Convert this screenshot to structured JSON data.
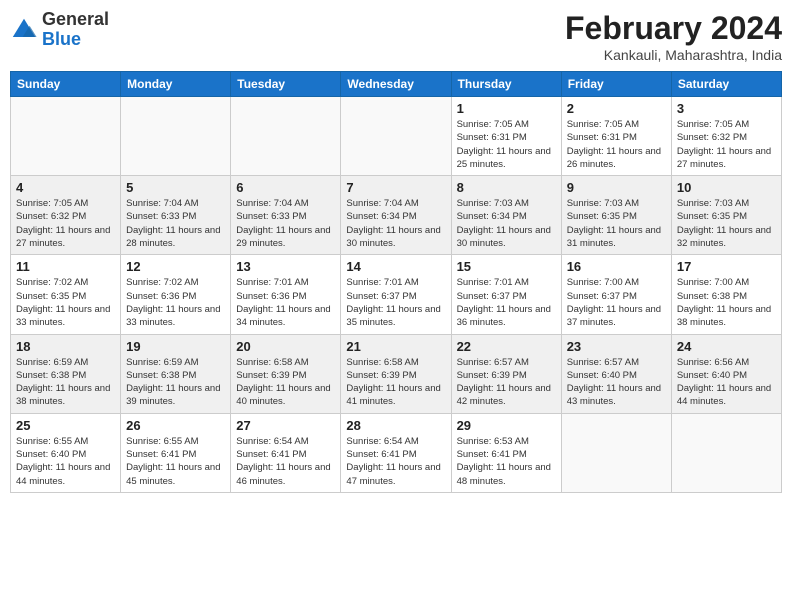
{
  "logo": {
    "general": "General",
    "blue": "Blue"
  },
  "header": {
    "month_year": "February 2024",
    "location": "Kankauli, Maharashtra, India"
  },
  "days_of_week": [
    "Sunday",
    "Monday",
    "Tuesday",
    "Wednesday",
    "Thursday",
    "Friday",
    "Saturday"
  ],
  "weeks": [
    [
      {
        "day": "",
        "info": ""
      },
      {
        "day": "",
        "info": ""
      },
      {
        "day": "",
        "info": ""
      },
      {
        "day": "",
        "info": ""
      },
      {
        "day": "1",
        "info": "Sunrise: 7:05 AM\nSunset: 6:31 PM\nDaylight: 11 hours and 25 minutes."
      },
      {
        "day": "2",
        "info": "Sunrise: 7:05 AM\nSunset: 6:31 PM\nDaylight: 11 hours and 26 minutes."
      },
      {
        "day": "3",
        "info": "Sunrise: 7:05 AM\nSunset: 6:32 PM\nDaylight: 11 hours and 27 minutes."
      }
    ],
    [
      {
        "day": "4",
        "info": "Sunrise: 7:05 AM\nSunset: 6:32 PM\nDaylight: 11 hours and 27 minutes."
      },
      {
        "day": "5",
        "info": "Sunrise: 7:04 AM\nSunset: 6:33 PM\nDaylight: 11 hours and 28 minutes."
      },
      {
        "day": "6",
        "info": "Sunrise: 7:04 AM\nSunset: 6:33 PM\nDaylight: 11 hours and 29 minutes."
      },
      {
        "day": "7",
        "info": "Sunrise: 7:04 AM\nSunset: 6:34 PM\nDaylight: 11 hours and 30 minutes."
      },
      {
        "day": "8",
        "info": "Sunrise: 7:03 AM\nSunset: 6:34 PM\nDaylight: 11 hours and 30 minutes."
      },
      {
        "day": "9",
        "info": "Sunrise: 7:03 AM\nSunset: 6:35 PM\nDaylight: 11 hours and 31 minutes."
      },
      {
        "day": "10",
        "info": "Sunrise: 7:03 AM\nSunset: 6:35 PM\nDaylight: 11 hours and 32 minutes."
      }
    ],
    [
      {
        "day": "11",
        "info": "Sunrise: 7:02 AM\nSunset: 6:35 PM\nDaylight: 11 hours and 33 minutes."
      },
      {
        "day": "12",
        "info": "Sunrise: 7:02 AM\nSunset: 6:36 PM\nDaylight: 11 hours and 33 minutes."
      },
      {
        "day": "13",
        "info": "Sunrise: 7:01 AM\nSunset: 6:36 PM\nDaylight: 11 hours and 34 minutes."
      },
      {
        "day": "14",
        "info": "Sunrise: 7:01 AM\nSunset: 6:37 PM\nDaylight: 11 hours and 35 minutes."
      },
      {
        "day": "15",
        "info": "Sunrise: 7:01 AM\nSunset: 6:37 PM\nDaylight: 11 hours and 36 minutes."
      },
      {
        "day": "16",
        "info": "Sunrise: 7:00 AM\nSunset: 6:37 PM\nDaylight: 11 hours and 37 minutes."
      },
      {
        "day": "17",
        "info": "Sunrise: 7:00 AM\nSunset: 6:38 PM\nDaylight: 11 hours and 38 minutes."
      }
    ],
    [
      {
        "day": "18",
        "info": "Sunrise: 6:59 AM\nSunset: 6:38 PM\nDaylight: 11 hours and 38 minutes."
      },
      {
        "day": "19",
        "info": "Sunrise: 6:59 AM\nSunset: 6:38 PM\nDaylight: 11 hours and 39 minutes."
      },
      {
        "day": "20",
        "info": "Sunrise: 6:58 AM\nSunset: 6:39 PM\nDaylight: 11 hours and 40 minutes."
      },
      {
        "day": "21",
        "info": "Sunrise: 6:58 AM\nSunset: 6:39 PM\nDaylight: 11 hours and 41 minutes."
      },
      {
        "day": "22",
        "info": "Sunrise: 6:57 AM\nSunset: 6:39 PM\nDaylight: 11 hours and 42 minutes."
      },
      {
        "day": "23",
        "info": "Sunrise: 6:57 AM\nSunset: 6:40 PM\nDaylight: 11 hours and 43 minutes."
      },
      {
        "day": "24",
        "info": "Sunrise: 6:56 AM\nSunset: 6:40 PM\nDaylight: 11 hours and 44 minutes."
      }
    ],
    [
      {
        "day": "25",
        "info": "Sunrise: 6:55 AM\nSunset: 6:40 PM\nDaylight: 11 hours and 44 minutes."
      },
      {
        "day": "26",
        "info": "Sunrise: 6:55 AM\nSunset: 6:41 PM\nDaylight: 11 hours and 45 minutes."
      },
      {
        "day": "27",
        "info": "Sunrise: 6:54 AM\nSunset: 6:41 PM\nDaylight: 11 hours and 46 minutes."
      },
      {
        "day": "28",
        "info": "Sunrise: 6:54 AM\nSunset: 6:41 PM\nDaylight: 11 hours and 47 minutes."
      },
      {
        "day": "29",
        "info": "Sunrise: 6:53 AM\nSunset: 6:41 PM\nDaylight: 11 hours and 48 minutes."
      },
      {
        "day": "",
        "info": ""
      },
      {
        "day": "",
        "info": ""
      }
    ]
  ]
}
